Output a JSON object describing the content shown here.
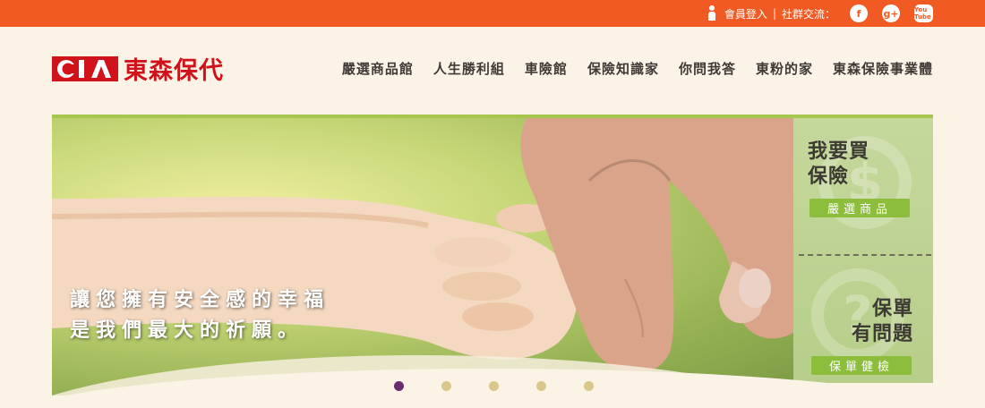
{
  "topbar": {
    "member_login": "會員登入",
    "separator": "|",
    "social_label": "社群交流：",
    "icons": [
      "person-icon",
      "facebook-icon",
      "google-plus-icon",
      "youtube-icon"
    ],
    "facebook": "f",
    "google_plus": "g+",
    "youtube": "You Tube",
    "bg_color": "#f15a22"
  },
  "logo": {
    "mark": "CIA",
    "name": "東森保代",
    "color": "#d0121b"
  },
  "nav": [
    "嚴選商品館",
    "人生勝利組",
    "車險館",
    "保險知識家",
    "你問我答",
    "東粉的家",
    "東森保險事業體"
  ],
  "banner": {
    "slogan_line1": "讓您擁有安全感的幸福",
    "slogan_line2": "是我們最大的祈願。",
    "slides": 5,
    "active_slide": 1
  },
  "side": {
    "buy": {
      "title_line1": "我要買",
      "title_line2": "保險",
      "button": "嚴選商品",
      "icon": "dollar-coin-icon"
    },
    "policy": {
      "title_line1": "保單",
      "title_line2": "有問題",
      "button": "保單健檢",
      "icon": "question-coin-icon"
    },
    "accent_color": "#8cbd3c"
  }
}
